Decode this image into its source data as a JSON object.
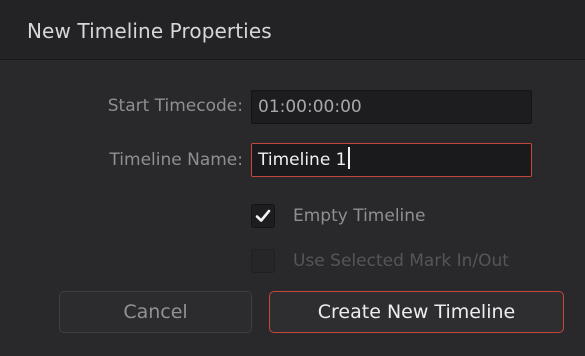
{
  "dialog": {
    "title": "New Timeline Properties"
  },
  "fields": {
    "start_timecode": {
      "label": "Start Timecode:",
      "value": "01:00:00:00"
    },
    "timeline_name": {
      "label": "Timeline Name:",
      "value": "Timeline 1"
    }
  },
  "options": {
    "empty_timeline": {
      "label": "Empty Timeline",
      "checked": true,
      "icon": "checkmark-icon"
    },
    "use_selected_mark": {
      "label": "Use Selected Mark In/Out",
      "checked": false,
      "enabled": false
    }
  },
  "buttons": {
    "cancel": "Cancel",
    "create": "Create New Timeline"
  },
  "colors": {
    "accent": "#c7473a",
    "background": "#29292b",
    "title_bar": "#232325"
  }
}
